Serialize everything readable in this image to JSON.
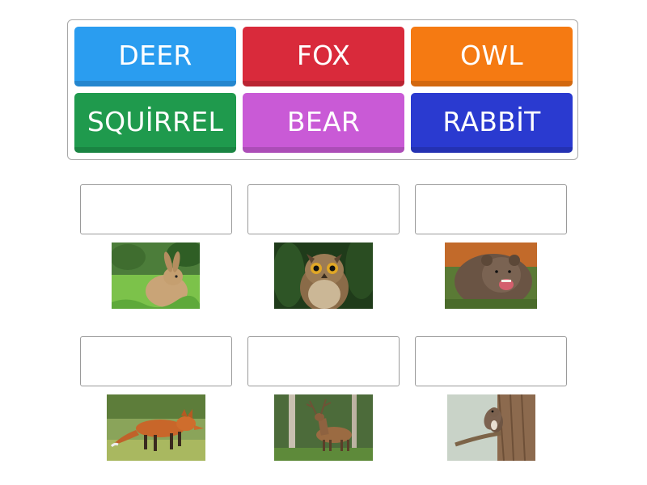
{
  "tiles": [
    {
      "label": "DEER",
      "color": "#2a9df0"
    },
    {
      "label": "FOX",
      "color": "#d92a3b"
    },
    {
      "label": "OWL",
      "color": "#f57a12"
    },
    {
      "label": "SQUİRREL",
      "color": "#1f9a4d"
    },
    {
      "label": "BEAR",
      "color": "#c95ad6"
    },
    {
      "label": "RABBİT",
      "color": "#2a3ad0"
    }
  ],
  "targets": [
    {
      "image": "rabbit-photo",
      "answer": ""
    },
    {
      "image": "owl-photo",
      "answer": ""
    },
    {
      "image": "bear-photo",
      "answer": ""
    },
    {
      "image": "fox-photo",
      "answer": ""
    },
    {
      "image": "deer-photo",
      "answer": ""
    },
    {
      "image": "squirrel-photo",
      "answer": ""
    }
  ]
}
